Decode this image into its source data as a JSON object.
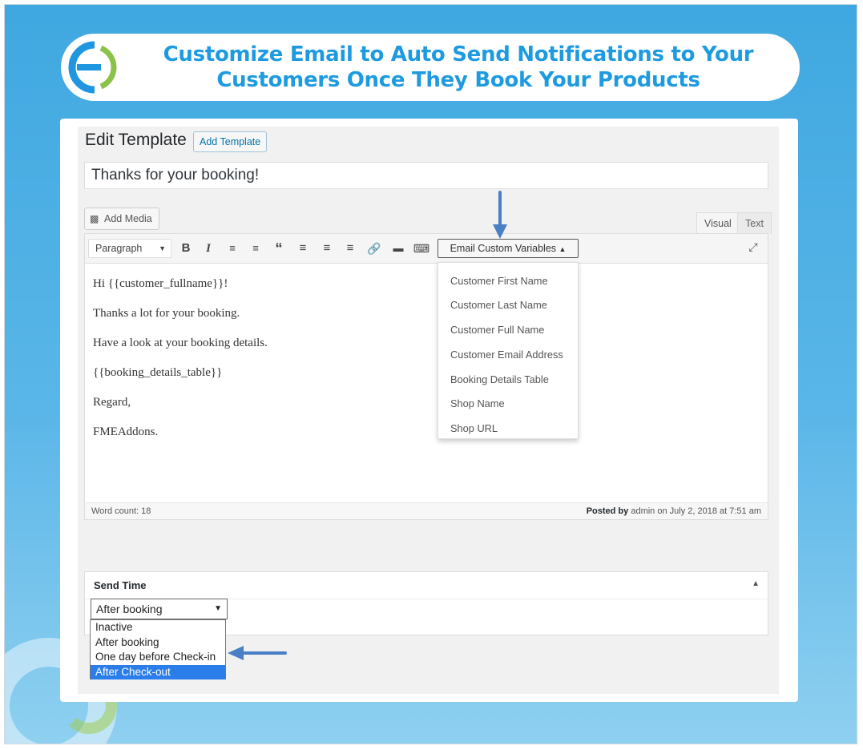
{
  "banner": {
    "title_line1": "Customize Email to Auto Send Notifications to Your",
    "title_line2": "Customers Once They Book Your Products",
    "logo_icon": "brand-logo-icon",
    "colors": {
      "title": "#1e9be0",
      "background": "#3fa8e0",
      "logo_green": "#7cb342"
    }
  },
  "page": {
    "heading": "Edit Template",
    "add_template_label": "Add Template",
    "title_value": "Thanks for your booking!"
  },
  "editor": {
    "add_media_label": "Add Media",
    "tabs": {
      "visual": "Visual",
      "text": "Text"
    },
    "format_select": "Paragraph",
    "toolbar_icons": [
      "bold-icon",
      "italic-icon",
      "bulleted-list-icon",
      "numbered-list-icon",
      "blockquote-icon",
      "align-left-icon",
      "align-center-icon",
      "align-right-icon",
      "link-icon",
      "read-more-icon",
      "toolbar-toggle-icon"
    ],
    "custom_variables_label": "Email Custom Variables",
    "custom_variables_menu": [
      "Customer First Name",
      "Customer Last Name",
      "Customer Full Name",
      "Customer Email Address",
      "Booking Details Table",
      "Shop Name",
      "Shop URL"
    ],
    "body_lines": [
      "Hi {{customer_fullname}}!",
      "Thanks a lot for your booking.",
      "Have a look at your booking details.",
      "{{booking_details_table}}",
      "Regard,",
      "FMEAddons."
    ],
    "word_count": "Word count: 18",
    "posted_by_label": "Posted by",
    "posted_by_text": "admin on July 2, 2018 at 7:51 am"
  },
  "send_time": {
    "title": "Send Time",
    "selected": "After booking",
    "options": [
      "Inactive",
      "After booking",
      "One day before Check-in",
      "After Check-out"
    ],
    "highlighted": "After Check-out",
    "highlight_color": "#2b7de9"
  }
}
